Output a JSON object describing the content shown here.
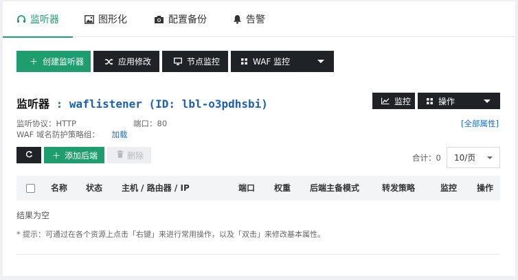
{
  "tabs": [
    {
      "label": "监听器",
      "icon": "headset-icon",
      "active": true
    },
    {
      "label": "图形化",
      "icon": "image-icon",
      "active": false
    },
    {
      "label": "配置备份",
      "icon": "camera-icon",
      "active": false
    },
    {
      "label": "告警",
      "icon": "bell-icon",
      "active": false
    }
  ],
  "toolbar": {
    "create_label": "创建监听器",
    "apply_label": "应用修改",
    "node_monitor_label": "节点监控",
    "waf_label": "WAF 监控"
  },
  "listener": {
    "prefix": "监听器",
    "sep": " : ",
    "name": "waflistener (ID: lbl-o3pdhsbi)",
    "monitor_label": "监控",
    "actions_label": "操作",
    "protocol": "监听协议：HTTP",
    "port": "端口：80",
    "waf_group": "WAF 域名防护策略组：",
    "load_label": "加载",
    "all_props": "[全部属性]"
  },
  "backend": {
    "add_label": "添加后端",
    "delete_label": "删除",
    "total": "合计：0",
    "page_size": "10/页"
  },
  "table": {
    "columns": [
      "名称",
      "状态",
      "主机 / 路由器 / IP",
      "端口",
      "权重",
      "后端主备模式",
      "转发策略",
      "监控",
      "操作"
    ],
    "empty_text": "结果为空"
  },
  "hint": "* 提示：可通过在各个资源上点击「右键」来进行常用操作，以及「双击」来修改基本属性。",
  "colors": {
    "accent": "#1e9e6e",
    "dark_button": "#1f2226",
    "link": "#1a6fcc"
  }
}
